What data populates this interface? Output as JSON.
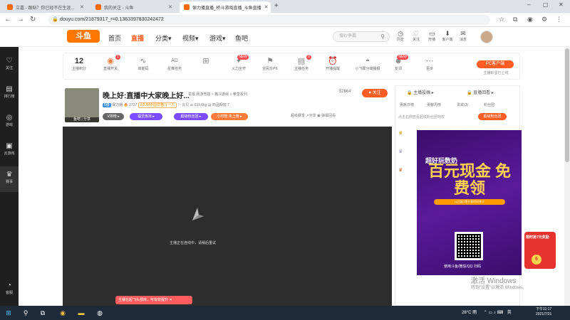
{
  "browser": {
    "tabs": [
      {
        "label": "立嘉 - 跟贴？你已经不在生涯...",
        "active": false,
        "color": "#ff6a00"
      },
      {
        "label": "我的关注 - 斗鱼",
        "active": false,
        "color": "#ff6a00"
      },
      {
        "label": "保力播直播_桥斗游戏直播_斗鱼直播",
        "active": true,
        "color": "#ff6a00"
      }
    ],
    "new_tab": "+",
    "url": "douyu.com/21879317_r=0.1363397830242472",
    "win_controls": [
      "–",
      "▢",
      "✕"
    ]
  },
  "header": {
    "logo": "斗鱼",
    "nav": [
      {
        "label": "首页",
        "active": false
      },
      {
        "label": "直播",
        "active": true
      },
      {
        "label": "分类▾",
        "active": false
      },
      {
        "label": "视频▾",
        "active": false
      },
      {
        "label": "游戏▾",
        "active": false
      },
      {
        "label": "鱼吧",
        "active": false
      }
    ],
    "search_placeholder": "搜纱争霸",
    "icons": [
      {
        "label": "历史",
        "glyph": "◷"
      },
      {
        "label": "关注",
        "glyph": "♡"
      },
      {
        "label": "开播",
        "glyph": "▭"
      },
      {
        "label": "客户端",
        "glyph": "⬇"
      },
      {
        "label": "消息",
        "glyph": "✉"
      }
    ]
  },
  "sidebar": {
    "items": [
      {
        "label": "关注",
        "glyph": "♡"
      },
      {
        "label": "排行榜",
        "glyph": "▤"
      },
      {
        "label": "游戏",
        "glyph": "◎"
      },
      {
        "label": "云游戏",
        "glyph": "▣"
      },
      {
        "label": "赛事",
        "glyph": "♛"
      },
      {
        "label": "客服",
        "glyph": "◔"
      }
    ]
  },
  "features": {
    "level_num": "12",
    "items": [
      {
        "label": "主播积分",
        "glyph": ""
      },
      {
        "label": "直播开关",
        "glyph": "◉",
        "badge": "1"
      },
      {
        "label": "高能码",
        "glyph": "∿"
      },
      {
        "label": "星推任务",
        "glyph": "AD"
      },
      {
        "label": "",
        "glyph": "⊞"
      },
      {
        "label": "火力全开",
        "glyph": "✦",
        "badge": "NEW"
      },
      {
        "label": "全民乐PK",
        "glyph": "⚑"
      },
      {
        "label": "主播任务",
        "glyph": "▤",
        "badge": "2"
      },
      {
        "label": "开播提醒",
        "glyph": "⏰"
      },
      {
        "label": "小飞碟分域播报",
        "glyph": "◓"
      },
      {
        "label": "友邻",
        "glyph": "☻",
        "badge": "NEW"
      },
      {
        "label": "更多",
        "glyph": "⋯"
      }
    ],
    "pc_client": "PC客户端",
    "pc_client_sub": "主播彩蛋已上线"
  },
  "room": {
    "title": "晚上好:直播中大家晚上好...",
    "links": "举报  网游竞技 > 格斗游戏 > 拳皇系列",
    "heat": "52664",
    "follow_label": "♥ 关注",
    "avatar_label": "鱼吧 | 分享",
    "meta_level": "5级",
    "meta_text": "保力播  🔥 2727",
    "meta_rank": "02UM中国爱格斗一人",
    "meta_more": "⚐ 云贝   ⚖ 633.6kg   ▤ 商品橱窗 7",
    "pills": [
      {
        "label": "V排榜 ▸",
        "color": "#666"
      },
      {
        "label": "福至炼狱 ▸",
        "color": "#7b4bff"
      },
      {
        "label": "超级粉丝团 ▸",
        "color": "#7b4bff"
      },
      {
        "label": "小时榜 未上榜 ▸",
        "color": "#ff7a3d"
      }
    ],
    "share_text": "超级赛季  ↗分享   ▣ 弹幕回看",
    "offline_text": "主播正在连线中，请稍后重试",
    "bottom_tip": "主播在起飞头部房，可有效提升 ✕"
  },
  "panel": {
    "tabs": [
      "🔒 主播投稿 ▸",
      "🔒 直播回看 ▸"
    ],
    "subtabs": [
      "贡献日榜",
      "贡献周榜",
      "贵宾(3)",
      "粉丝团"
    ],
    "notice": "点击右侧查看超级粉丝团特权",
    "btn": "超级粉丝团"
  },
  "ad": {
    "headline": "超好玩数奶",
    "big": "百元现金 免费领",
    "sub": "11日起1等分享时间多少",
    "qr_text": "使用斗鱼/微信/QQ 扫码"
  },
  "float": {
    "gift_title": "限时抢7元奖励",
    "gift_num": "6"
  },
  "watermark": {
    "title": "激活 Windows",
    "sub": "转到“设置”以激活 Windows。"
  },
  "taskbar": {
    "weather": "28°C 雨",
    "ime": "英",
    "time": "下午11:17",
    "date": "2021/7/31"
  }
}
